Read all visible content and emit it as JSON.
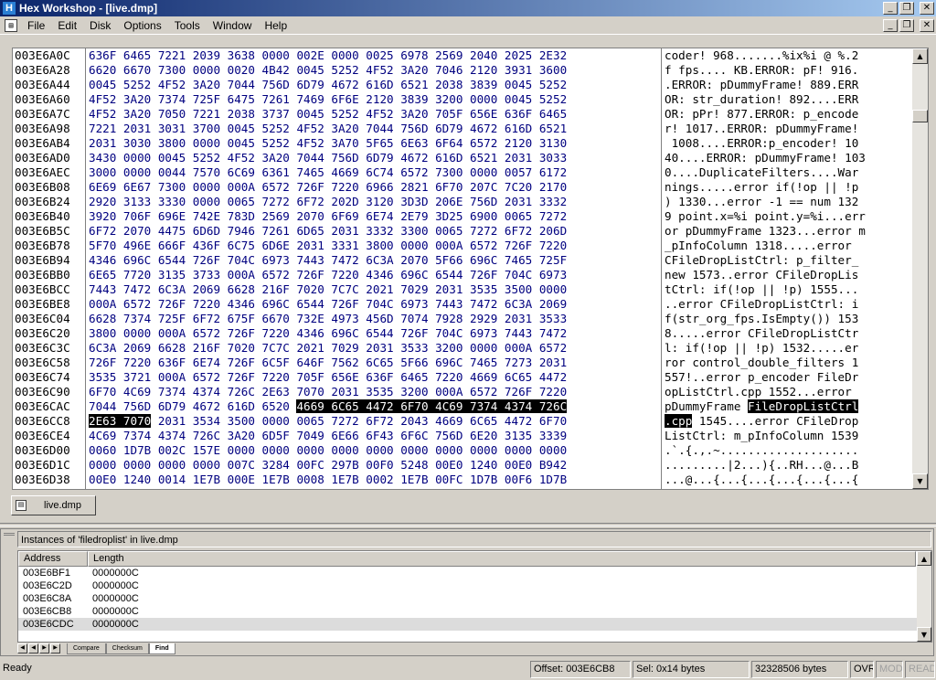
{
  "window": {
    "title": "Hex Workshop - [live.dmp]",
    "app_icon": "H",
    "btn_minimize": "_",
    "btn_restore": "❐",
    "btn_close": "✕"
  },
  "menu": [
    "File",
    "Edit",
    "Disk",
    "Options",
    "Tools",
    "Window",
    "Help"
  ],
  "hex": {
    "rows": [
      {
        "addr": "003E6A0C",
        "words": "636F 6465 7221 2039 3638 0000 002E 0000 0025 6978 2569 2040 2025 2E32",
        "ascii": "coder! 968.......%ix%i @ %.2"
      },
      {
        "addr": "003E6A28",
        "words": "6620 6670 7300 0000 0020 4B42 0045 5252 4F52 3A20 7046 2120 3931 3600",
        "ascii": "f fps.... KB.ERROR: pF! 916."
      },
      {
        "addr": "003E6A44",
        "words": "0045 5252 4F52 3A20 7044 756D 6D79 4672 616D 6521 2038 3839 0045 5252",
        "ascii": ".ERROR: pDummyFrame! 889.ERR"
      },
      {
        "addr": "003E6A60",
        "words": "4F52 3A20 7374 725F 6475 7261 7469 6F6E 2120 3839 3200 0000 0045 5252",
        "ascii": "OR: str_duration! 892....ERR"
      },
      {
        "addr": "003E6A7C",
        "words": "4F52 3A20 7050 7221 2038 3737 0045 5252 4F52 3A20 705F 656E 636F 6465",
        "ascii": "OR: pPr! 877.ERROR: p_encode"
      },
      {
        "addr": "003E6A98",
        "words": "7221 2031 3031 3700 0045 5252 4F52 3A20 7044 756D 6D79 4672 616D 6521",
        "ascii": "r! 1017..ERROR: pDummyFrame!"
      },
      {
        "addr": "003E6AB4",
        "words": "2031 3030 3800 0000 0045 5252 4F52 3A70 5F65 6E63 6F64 6572 2120 3130",
        "ascii": " 1008....ERROR:p_encoder! 10"
      },
      {
        "addr": "003E6AD0",
        "words": "3430 0000 0045 5252 4F52 3A20 7044 756D 6D79 4672 616D 6521 2031 3033",
        "ascii": "40....ERROR: pDummyFrame! 103"
      },
      {
        "addr": "003E6AEC",
        "words": "3000 0000 0044 7570 6C69 6361 7465 4669 6C74 6572 7300 0000 0057 6172",
        "ascii": "0....DuplicateFilters....War"
      },
      {
        "addr": "003E6B08",
        "words": "6E69 6E67 7300 0000 000A 6572 726F 7220 6966 2821 6F70 207C 7C20 2170",
        "ascii": "nings.....error if(!op || !p"
      },
      {
        "addr": "003E6B24",
        "words": "2920 3133 3330 0000 0065 7272 6F72 202D 3120 3D3D 206E 756D 2031 3332",
        "ascii": ") 1330...error -1 == num 132"
      },
      {
        "addr": "003E6B40",
        "words": "3920 706F 696E 742E 783D 2569 2070 6F69 6E74 2E79 3D25 6900 0065 7272",
        "ascii": "9 point.x=%i point.y=%i...err"
      },
      {
        "addr": "003E6B5C",
        "words": "6F72 2070 4475 6D6D 7946 7261 6D65 2031 3332 3300 0065 7272 6F72 206D",
        "ascii": "or pDummyFrame 1323...error m"
      },
      {
        "addr": "003E6B78",
        "words": "5F70 496E 666F 436F 6C75 6D6E 2031 3331 3800 0000 000A 6572 726F 7220",
        "ascii": "_pInfoColumn 1318.....error "
      },
      {
        "addr": "003E6B94",
        "words": "4346 696C 6544 726F 704C 6973 7443 7472 6C3A 2070 5F66 696C 7465 725F",
        "ascii": "CFileDropListCtrl: p_filter_"
      },
      {
        "addr": "003E6BB0",
        "words": "6E65 7720 3135 3733 000A 6572 726F 7220 4346 696C 6544 726F 704C 6973",
        "ascii": "new 1573..error CFileDropLis"
      },
      {
        "addr": "003E6BCC",
        "words": "7443 7472 6C3A 2069 6628 216F 7020 7C7C 2021 7029 2031 3535 3500 0000",
        "ascii": "tCtrl: if(!op || !p) 1555..."
      },
      {
        "addr": "003E6BE8",
        "words": "000A 6572 726F 7220 4346 696C 6544 726F 704C 6973 7443 7472 6C3A 2069",
        "ascii": "..error CFileDropListCtrl: i"
      },
      {
        "addr": "003E6C04",
        "words": "6628 7374 725F 6F72 675F 6670 732E 4973 456D 7074 7928 2929 2031 3533",
        "ascii": "f(str_org_fps.IsEmpty()) 153"
      },
      {
        "addr": "003E6C20",
        "words": "3800 0000 000A 6572 726F 7220 4346 696C 6544 726F 704C 6973 7443 7472",
        "ascii": "8.....error CFileDropListCtr"
      },
      {
        "addr": "003E6C3C",
        "words": "6C3A 2069 6628 216F 7020 7C7C 2021 7029 2031 3533 3200 0000 000A 6572",
        "ascii": "l: if(!op || !p) 1532.....er"
      },
      {
        "addr": "003E6C58",
        "words": "726F 7220 636F 6E74 726F 6C5F 646F 7562 6C65 5F66 696C 7465 7273 2031",
        "ascii": "ror control_double_filters 1"
      },
      {
        "addr": "003E6C74",
        "words": "3535 3721 000A 6572 726F 7220 705F 656E 636F 6465 7220 4669 6C65 4472",
        "ascii": "557!..error p_encoder FileDr"
      },
      {
        "addr": "003E6C90",
        "words": "6F70 4C69 7374 4374 726C 2E63 7070 2031 3535 3200 000A 6572 726F 7220",
        "ascii": "opListCtrl.cpp 1552...error "
      },
      {
        "addr": "003E6CAC",
        "words": "7044 756D 6D79 4672 616D 6520 ",
        "words_sel": "4669 6C65 4472 6F70 4C69 7374 4374 726C",
        "ascii": "pDummyFrame ",
        "ascii_sel": "FileDropListCtrl"
      },
      {
        "addr": "003E6CC8",
        "words_sel_pre": "2E63 7070",
        "words": " 2031 3534 3500 0000 0065 7272 6F72 2043 4669 6C65 4472 6F70",
        "ascii_sel_pre": ".cpp",
        "ascii": " 1545....error CFileDrop"
      },
      {
        "addr": "003E6CE4",
        "words": "4C69 7374 4374 726C 3A20 6D5F 7049 6E66 6F43 6F6C 756D 6E20 3135 3339",
        "ascii": "ListCtrl: m_pInfoColumn 1539"
      },
      {
        "addr": "003E6D00",
        "words": "0060 1D7B 002C 157E 0000 0000 0000 0000 0000 0000 0000 0000 0000 0000",
        "ascii": ".`.{.,.~...................."
      },
      {
        "addr": "003E6D1C",
        "words": "0000 0000 0000 0000 007C 3284 00FC 297B 00F0 5248 00E0 1240 00E0 B942",
        "ascii": ".........|2...){..RH...@...B"
      },
      {
        "addr": "003E6D38",
        "words": "00E0 1240 0014 1E7B 000E 1E7B 0008 1E7B 0002 1E7B 00FC 1D7B 00F6 1D7B",
        "ascii": "...@...{...{...{...{...{...{"
      }
    ]
  },
  "doc_tab": {
    "label": "live.dmp",
    "icon": "▤"
  },
  "results": {
    "caption": "Instances of 'filedroplist' in live.dmp",
    "columns": {
      "address": "Address",
      "length": "Length"
    },
    "rows": [
      {
        "address": "003E6BF1",
        "length": "0000000C"
      },
      {
        "address": "003E6C2D",
        "length": "0000000C"
      },
      {
        "address": "003E6C8A",
        "length": "0000000C"
      },
      {
        "address": "003E6CB8",
        "length": "0000000C"
      },
      {
        "address": "003E6CDC",
        "length": "0000000C"
      }
    ],
    "tabs": [
      "Compare",
      "Checksum",
      "Find"
    ]
  },
  "status": {
    "ready": "Ready",
    "offset": "Offset: 003E6CB8",
    "sel": "Sel: 0x14 bytes",
    "size": "32328506 bytes",
    "ovr": "OVR",
    "mod": "MOD",
    "read": "READ"
  }
}
